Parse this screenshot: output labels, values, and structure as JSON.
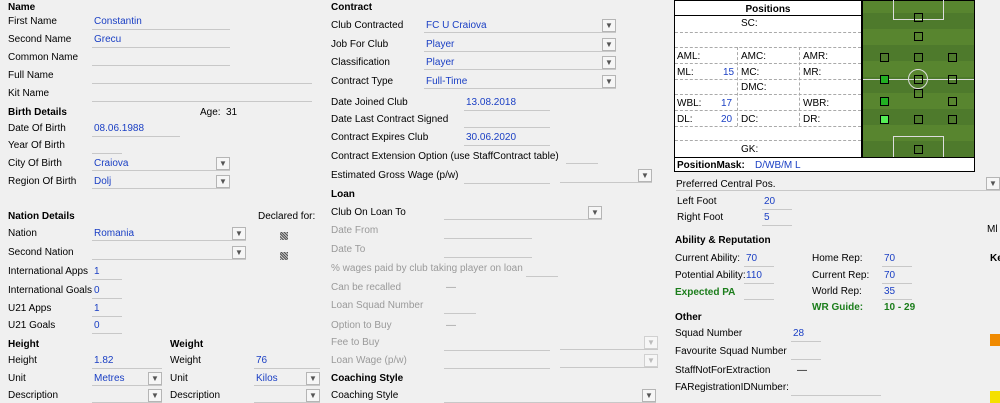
{
  "col1": {
    "name_header": "Name",
    "first_name_label": "First Name",
    "first_name": "Constantin",
    "second_name_label": "Second Name",
    "second_name": "Grecu",
    "common_name_label": "Common Name",
    "full_name_label": "Full Name",
    "kit_name_label": "Kit Name",
    "birth_header": "Birth Details",
    "age_label": "Age:",
    "age": "31",
    "dob_label": "Date Of Birth",
    "dob": "08.06.1988",
    "yob_label": "Year Of Birth",
    "city_label": "City Of Birth",
    "city": "Craiova",
    "region_label": "Region Of Birth",
    "region": "Dolj",
    "nation_header": "Nation Details",
    "declared_for": "Declared for:",
    "nation_label": "Nation",
    "nation": "Romania",
    "second_nation_label": "Second Nation",
    "int_apps_label": "International Apps",
    "int_apps": "1",
    "int_goals_label": "International Goals",
    "int_goals": "0",
    "u21_apps_label": "U21 Apps",
    "u21_apps": "1",
    "u21_goals_label": "U21 Goals",
    "u21_goals": "0",
    "height_header": "Height",
    "height_label": "Height",
    "height": "1.82",
    "unit_label": "Unit",
    "height_unit": "Metres",
    "description_label": "Description",
    "weight_header": "Weight",
    "weight_label": "Weight",
    "weight": "76",
    "weight_unit": "Kilos"
  },
  "col2": {
    "contract_header": "Contract",
    "club_contracted_label": "Club Contracted",
    "club_contracted": "FC U Craiova",
    "job_label": "Job For Club",
    "job": "Player",
    "classification_label": "Classification",
    "classification": "Player",
    "contract_type_label": "Contract Type",
    "contract_type": "Full-Time",
    "date_joined_label": "Date Joined Club",
    "date_joined": "13.08.2018",
    "date_last_signed_label": "Date Last Contract Signed",
    "expires_label": "Contract Expires Club",
    "expires": "30.06.2020",
    "extension_label": "Contract Extension Option (use StaffContract table)",
    "wage_label": "Estimated Gross Wage (p/w)",
    "loan_header": "Loan",
    "loan_club_label": "Club On Loan To",
    "date_from_label": "Date From",
    "date_to_label": "Date To",
    "wages_paid_label": "% wages paid by club taking player on loan",
    "recalled_label": "Can be recalled",
    "loan_squad_label": "Loan Squad Number",
    "option_buy_label": "Option to Buy",
    "fee_buy_label": "Fee to Buy",
    "loan_wage_label": "Loan Wage (p/w)",
    "coaching_header": "Coaching Style",
    "coaching_label": "Coaching Style",
    "dash": "—"
  },
  "positions": {
    "title": "Positions",
    "sc": "SC:",
    "aml": "AML:",
    "amc": "AMC:",
    "amr": "AMR:",
    "ml": "ML:",
    "ml_val": "15",
    "mc": "MC:",
    "mr": "MR:",
    "dmc": "DMC:",
    "wbl": "WBL:",
    "wbl_val": "17",
    "wbr": "WBR:",
    "dl": "DL:",
    "dl_val": "20",
    "dc": "DC:",
    "dr": "DR:",
    "gk": "GK:",
    "mask_label": "PositionMask:",
    "mask": "D/WB/M L"
  },
  "col3": {
    "pref_central_label": "Preferred Central Pos.",
    "left_foot_label": "Left Foot",
    "left_foot": "20",
    "right_foot_label": "Right Foot",
    "right_foot": "5",
    "ability_header": "Ability & Reputation",
    "ca_label": "Current Ability:",
    "ca": "70",
    "pa_label": "Potential Ability:",
    "pa": "110",
    "expected_pa_label": "Expected PA",
    "home_rep_label": "Home Rep:",
    "home_rep": "70",
    "current_rep_label": "Current Rep:",
    "current_rep": "70",
    "world_rep_label": "World Rep:",
    "world_rep": "35",
    "wr_guide_label": "WR Guide:",
    "wr_guide": "10 - 29",
    "other_header": "Other",
    "squad_number_label": "Squad Number",
    "squad_number": "28",
    "fav_squad_label": "Favourite Squad Number",
    "staff_not_label": "StaffNotForExtraction",
    "fa_reg_label": "FARegistrationIDNumber:",
    "edge_m": "Ml",
    "edge_k": "Ke"
  },
  "colors": {
    "accent_value": "#1a3fc4",
    "guide_green": "#1b7d1b",
    "pitch": "#4e7a2c",
    "swatch_orange": "#f08a00",
    "swatch_yellow": "#f5e000"
  }
}
